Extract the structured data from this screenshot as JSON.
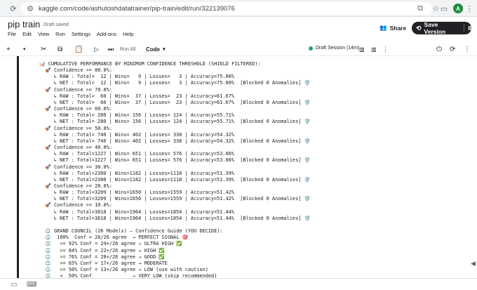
{
  "browser": {
    "url": "kaggle.com/code/ashutoshdatatrainer/pip-train/edit/run/322139076",
    "avatar_initial": "A"
  },
  "notebook": {
    "title": "pip train",
    "status": "Draft saved",
    "menu": [
      "File",
      "Edit",
      "View",
      "Run",
      "Settings",
      "Add-ons",
      "Help"
    ],
    "share_label": "Share",
    "save_label": "Save Version",
    "version_count": "8"
  },
  "toolbar": {
    "run_all_label": "Run All",
    "cell_type": "Code",
    "session_label": "Draft Session (14m)"
  },
  "output_lines": [
    "📊 CUMULATIVE PERFORMANCE BY MINIMUM CONFIDENCE THRESHOLD (SHIELD FILTERED):",
    "  🚀 Confidence >= 80.0%:",
    "     ↳ RAW : Total=  12 | Wins=   9 | Losses=   3 | Accuracy=75.00%",
    "     ↳ NET : Total=  12 | Wins=   9 | Losses=   3 | Accuracy=75.00%  [Blocked 0 Anomalies] 🛡️",
    "  🚀 Confidence >= 70.0%:",
    "     ↳ RAW : Total=  60 | Wins=  37 | Losses=  23 | Accuracy=61.67%",
    "     ↳ NET : Total=  60 | Wins=  37 | Losses=  23 | Accuracy=61.67%  [Blocked 0 Anomalies] 🛡️",
    "  🚀 Confidence >= 60.0%:",
    "     ↳ RAW : Total= 280 | Wins= 156 | Losses= 124 | Accuracy=55.71%",
    "     ↳ NET : Total= 280 | Wins= 156 | Losses= 124 | Accuracy=55.71%  [Blocked 0 Anomalies] 🛡️",
    "  🚀 Confidence >= 50.0%:",
    "     ↳ RAW : Total= 740 | Wins= 402 | Losses= 338 | Accuracy=54.32%",
    "     ↳ NET : Total= 740 | Wins= 402 | Losses= 338 | Accuracy=54.32%  [Blocked 0 Anomalies] 🛡️",
    "  🚀 Confidence >= 40.0%:",
    "     ↳ RAW : Total=1227 | Wins= 651 | Losses= 576 | Accuracy=53.06%",
    "     ↳ NET : Total=1227 | Wins= 651 | Losses= 576 | Accuracy=53.06%  [Blocked 0 Anomalies] 🛡️",
    "  🚀 Confidence >= 30.0%:",
    "     ↳ RAW : Total=2300 | Wins=1182 | Losses=1118 | Accuracy=51.39%",
    "     ↳ NET : Total=2300 | Wins=1182 | Losses=1118 | Accuracy=51.39%  [Blocked 0 Anomalies] 🛡️",
    "  🚀 Confidence >= 20.0%:",
    "     ↳ RAW : Total=3209 | Wins=1650 | Losses=1559 | Accuracy=51.42%",
    "     ↳ NET : Total=3209 | Wins=1650 | Losses=1559 | Accuracy=51.42%  [Blocked 0 Anomalies] 🛡️",
    "  🚀 Confidence >= 10.0%:",
    "     ↳ RAW : Total=3818 | Wins=1964 | Losses=1854 | Accuracy=51.44%",
    "     ↳ NET : Total=3818 | Wins=1964 | Losses=1854 | Accuracy=51.44%  [Blocked 0 Anomalies] 🛡️",
    "",
    "  ⚖️ GRAND COUNCIL (26 Models) — Confidence Guide (YOU DECIDE):",
    "  ⚖️  100%  Conf = 26/26 agree  → PERFECT SIGNAL 🎯",
    "  ⚖️   >= 92% Conf = 24+/26 agree → ULTRA HIGH ✅",
    "  ⚖️   >= 84% Conf = 22+/26 agree → HIGH ✅",
    "  ⚖️   >= 76% Conf = 20+/26 agree → GOOD ✅",
    "  ⚖️   >= 65% Conf = 17+/26 agree → MODERATE",
    "  ⚖️   >= 50% Conf = 13+/26 agree → LOW (use with caution)",
    "  ⚖️   <  50% Conf              → VERY LOW (skip recommended)"
  ]
}
